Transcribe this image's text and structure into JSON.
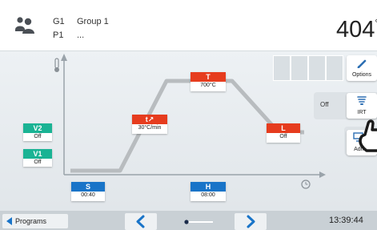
{
  "header": {
    "group_code": "G1",
    "group_name": "Group 1",
    "program_code": "P1",
    "program_name": "...",
    "current_temperature": "404",
    "temperature_unit": "°"
  },
  "graph": {
    "steps": {
      "V2": {
        "label": "V2",
        "value": "Off"
      },
      "V1": {
        "label": "V1",
        "value": "Off"
      },
      "S": {
        "label": "S",
        "value": "00:40"
      },
      "t": {
        "label": "t↗",
        "value": "30°C/min"
      },
      "T": {
        "label": "T",
        "value": "700°C"
      },
      "L": {
        "label": "L",
        "value": "Off"
      },
      "H": {
        "label": "H",
        "value": "08:00"
      }
    },
    "icons": {
      "y_axis": "thermometer-icon",
      "x_axis": "clock-icon"
    }
  },
  "side": {
    "options_label": "Options",
    "irt_state": "Off",
    "irt_label": "IRT",
    "admin_label": "Admin"
  },
  "footer": {
    "programs_label": "Programs",
    "time": "13:39:44"
  },
  "colors": {
    "accent_red": "#e63c1e",
    "accent_blue": "#1974c8",
    "accent_green": "#1ab394",
    "curve": "#b8bcbf"
  }
}
